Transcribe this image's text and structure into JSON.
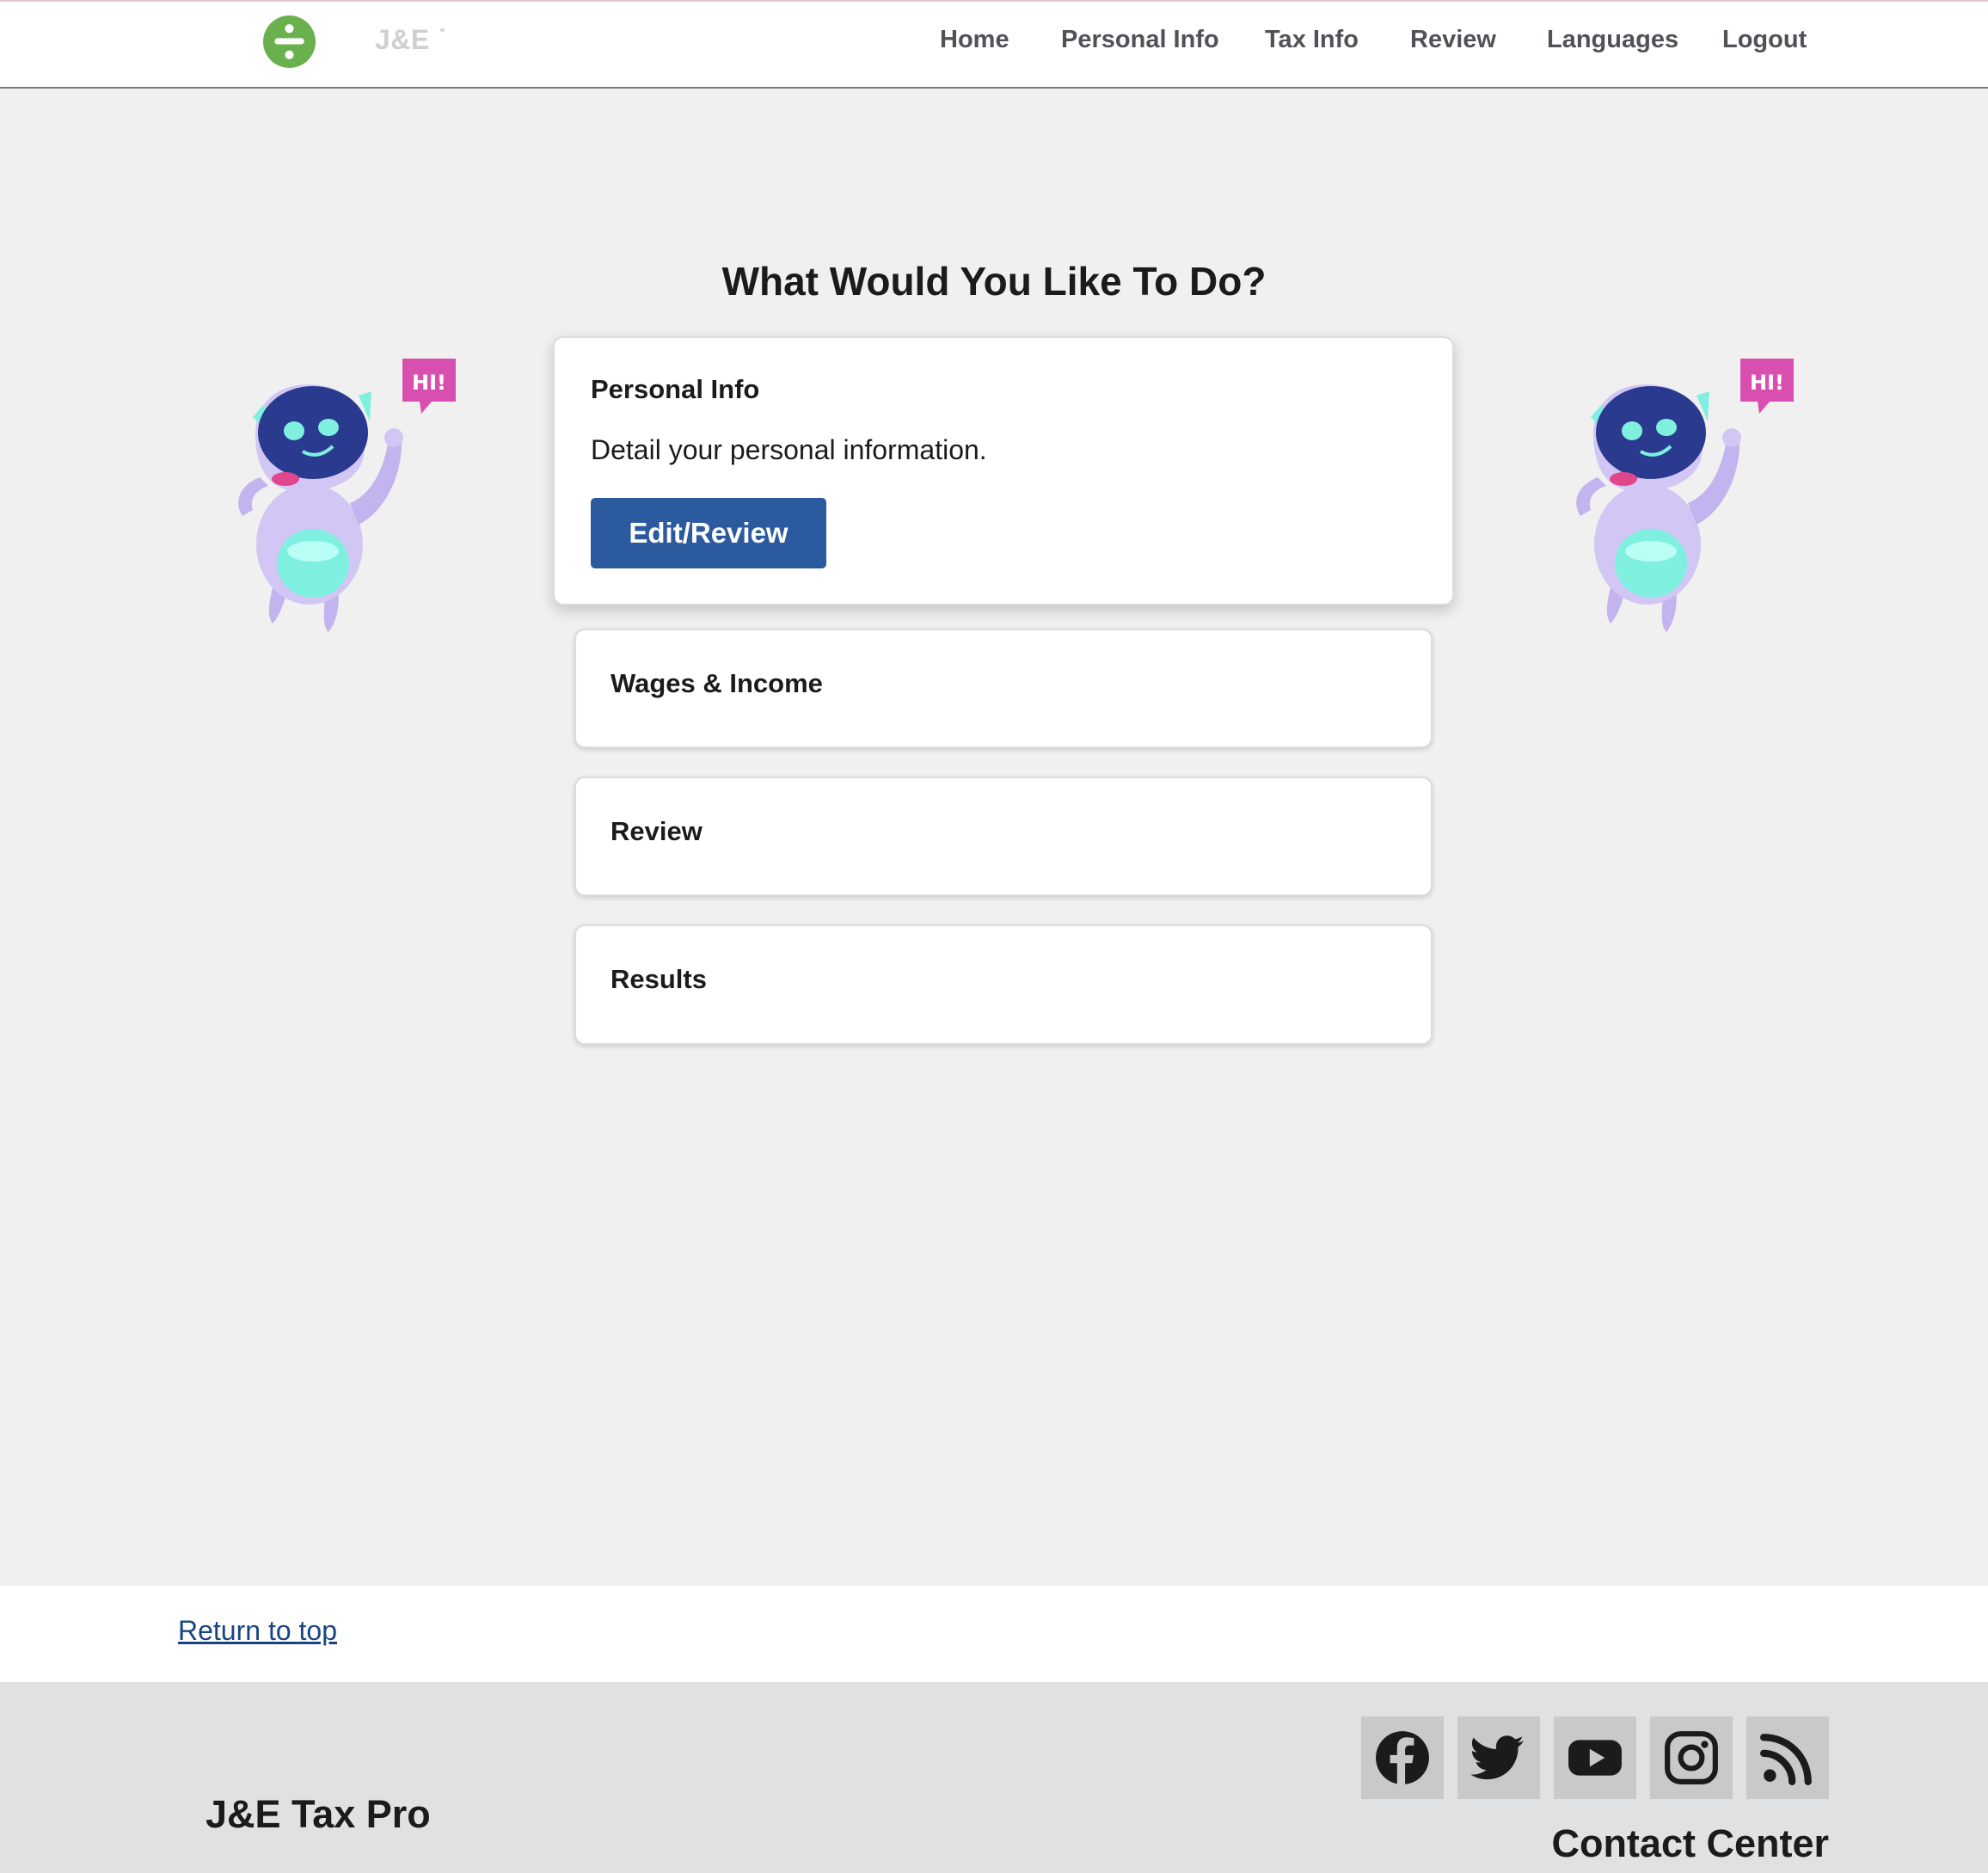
{
  "header": {
    "logo_text": "J&E ˙",
    "nav": [
      {
        "label": "Home"
      },
      {
        "label": "Personal Info"
      },
      {
        "label": "Tax Info"
      },
      {
        "label": "Review"
      },
      {
        "label": "Languages"
      },
      {
        "label": "Logout"
      }
    ]
  },
  "main": {
    "title": "What Would You Like To Do?",
    "mascot_bubble": "HI!",
    "cards": [
      {
        "title": "Personal Info",
        "description": "Detail your personal information.",
        "button_label": "Edit/Review",
        "expanded": true
      },
      {
        "title": "Wages & Income",
        "expanded": false
      },
      {
        "title": "Review",
        "expanded": false
      },
      {
        "title": "Results",
        "expanded": false
      }
    ]
  },
  "return_to_top": "Return to top",
  "footer": {
    "brand": "J&E Tax Pro",
    "contact_title": "Contact Center",
    "social": [
      {
        "icon": "facebook-icon"
      },
      {
        "icon": "twitter-icon"
      },
      {
        "icon": "youtube-icon"
      },
      {
        "icon": "instagram-icon"
      },
      {
        "icon": "rss-icon"
      }
    ]
  },
  "colors": {
    "primary_button": "#2c5a9e",
    "logo_green": "#6ab04c",
    "link": "#1a4480",
    "page_bg": "#f0f0f0",
    "footer_bg": "#dfe1e2"
  }
}
